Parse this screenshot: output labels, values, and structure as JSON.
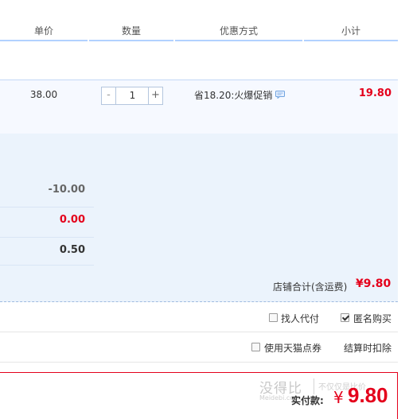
{
  "header": {
    "price": "单价",
    "quantity": "数量",
    "promotion": "优惠方式",
    "subtotal": "小计"
  },
  "item": {
    "price": "38.00",
    "quantity_minus": "-",
    "quantity": "1",
    "quantity_plus": "+",
    "promotion": "省18.20:火爆促销",
    "promotion_icon": "comment-bubble-icon",
    "subtotal": "19.80"
  },
  "summary": {
    "values": [
      "-10.00",
      "0.00",
      "0.50"
    ],
    "shop_total_label": "店铺合计(含运费)",
    "shop_total_value": "¥9.80"
  },
  "options": {
    "find_payer": {
      "label": "找人代付",
      "checked": false
    },
    "anonymous": {
      "label": "匿名购买",
      "checked": true
    },
    "tmall_points": {
      "label": "使用天猫点券",
      "checked": false
    },
    "deduct_note": "结算时扣除"
  },
  "payment": {
    "label": "实付款:",
    "currency": "¥",
    "amount": "9.80"
  },
  "watermark": {
    "logo": "没得比",
    "sub": "Meidebi.com",
    "tagline": "不仅仅是比价"
  },
  "colors": {
    "accent_red": "#e4001b",
    "header_border": "#b2d1ff",
    "summary_bg": "#ebf3fc"
  }
}
